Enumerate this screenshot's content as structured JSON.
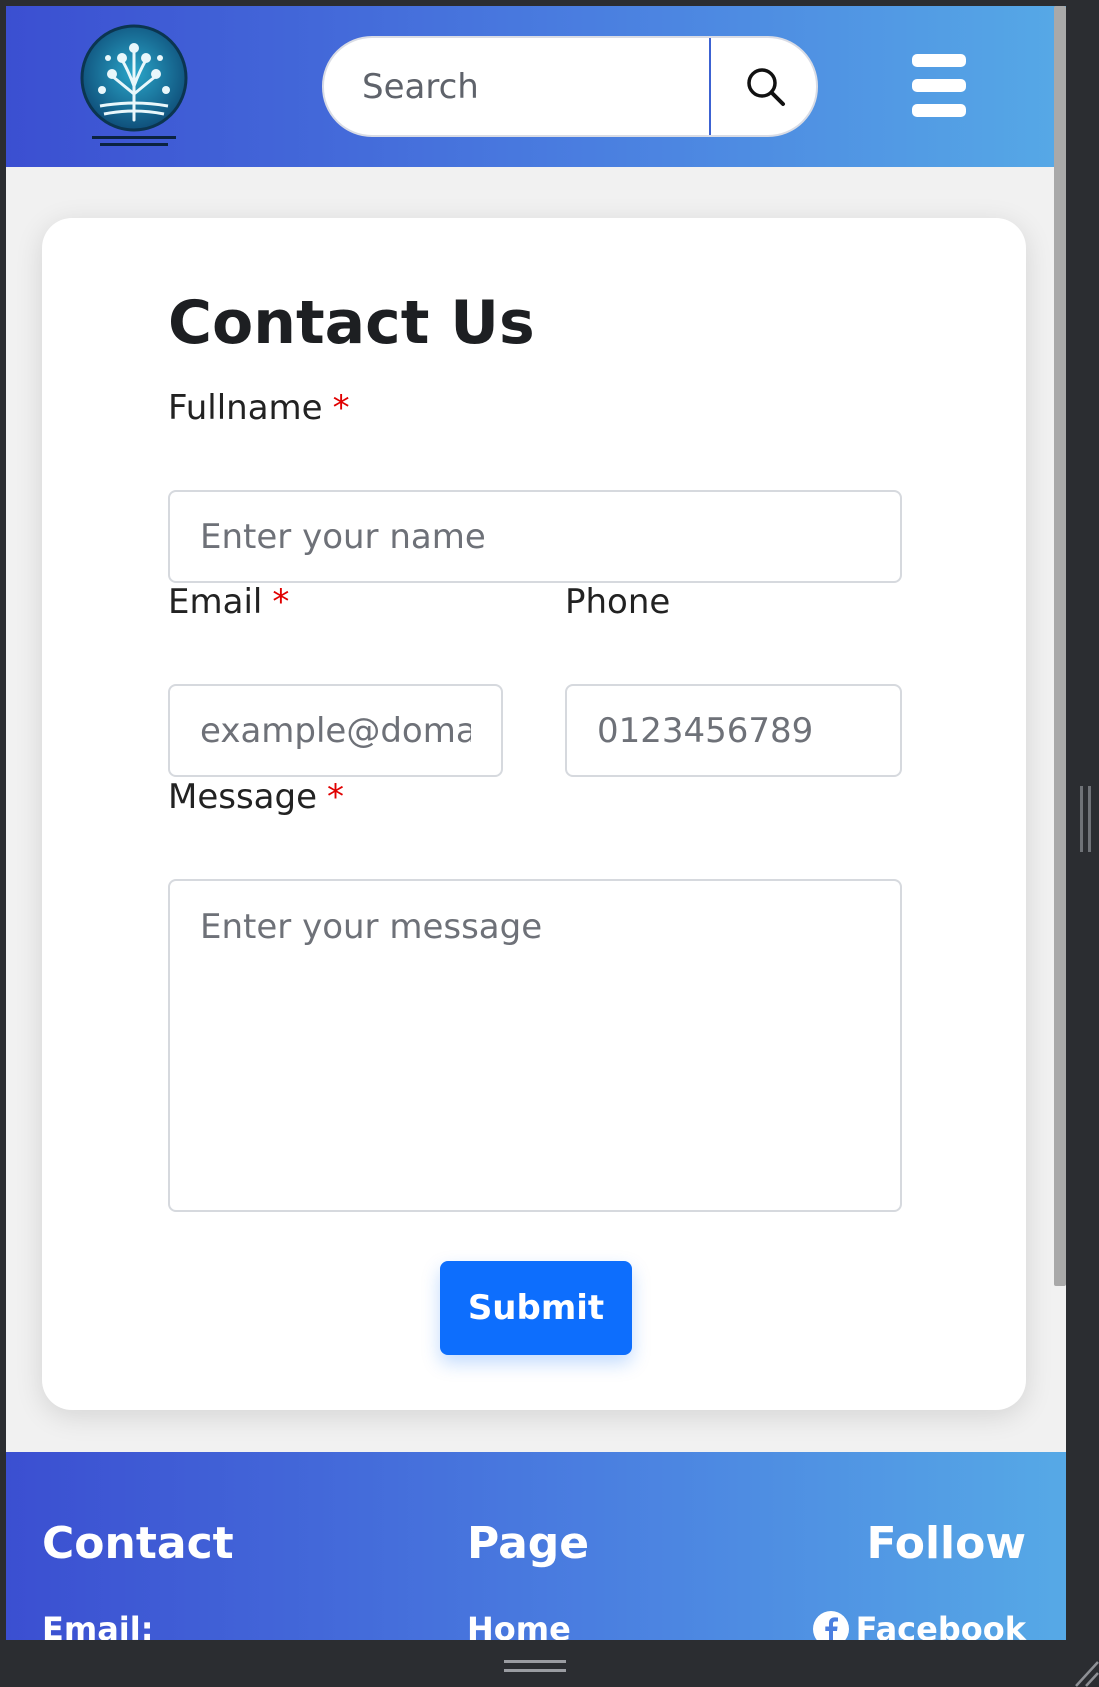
{
  "header": {
    "search_placeholder": "Search"
  },
  "contact_form": {
    "title": "Contact Us",
    "fullname_label": "Fullname",
    "fullname_placeholder": "Enter your name",
    "email_label": "Email",
    "email_placeholder": "example@domain.com",
    "phone_label": "Phone",
    "phone_placeholder": "0123456789",
    "message_label": "Message",
    "message_placeholder": "Enter your message",
    "required_mark": "*",
    "submit_label": "Submit"
  },
  "footer": {
    "contact_heading": "Contact",
    "page_heading": "Page",
    "follow_heading": "Follow",
    "contact_email_label": "Email:",
    "page_link_home": "Home",
    "follow_link_facebook": "Facebook"
  },
  "colors": {
    "header_gradient_start": "#3b4fd1",
    "header_gradient_end": "#56a9e6",
    "primary_button": "#0d6efd",
    "required": "#e00000"
  },
  "icons": {
    "logo": "tree-logo-icon",
    "search": "search-icon",
    "menu": "hamburger-menu-icon",
    "facebook": "facebook-icon"
  }
}
